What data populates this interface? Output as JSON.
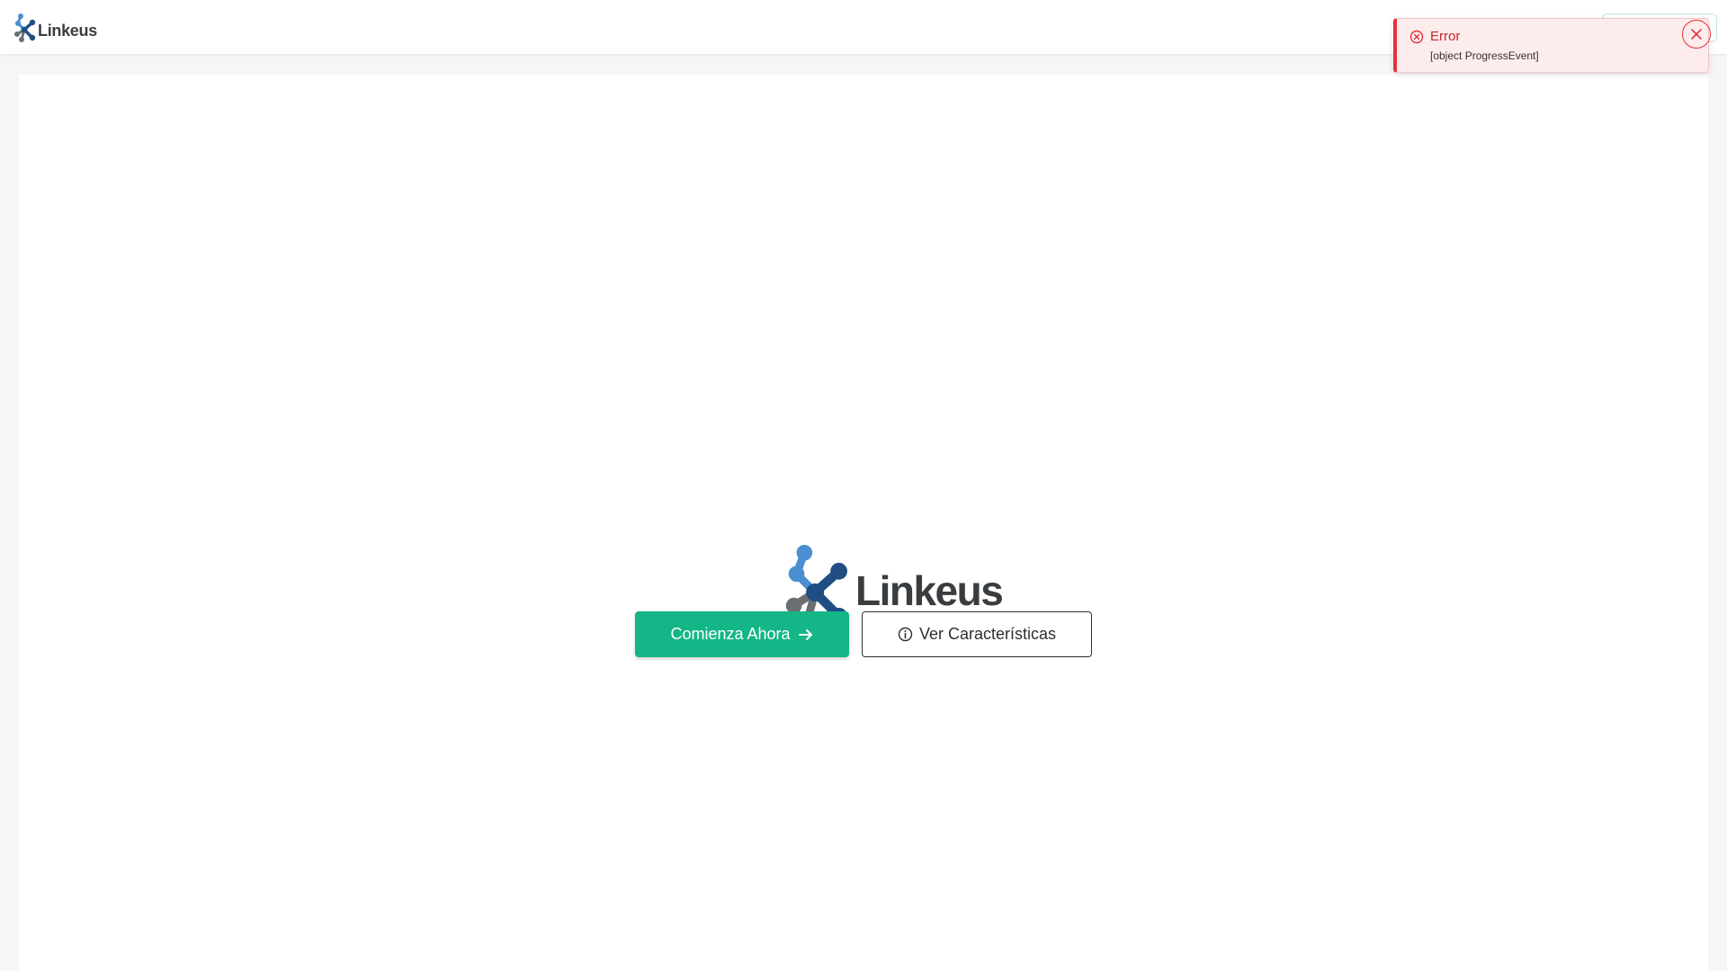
{
  "navbar": {
    "logo_text": "Linkeus"
  },
  "hero": {
    "logo_text": "Linkeus",
    "primary_button_label": "Comienza Ahora",
    "secondary_button_label": "Ver Características"
  },
  "toast": {
    "title": "Error",
    "message": "[object ProgressEvent]"
  },
  "icons": {
    "primary_button_icon": "arrow-right-icon",
    "secondary_button_icon": "info-circle-icon",
    "toast_icon": "error-circle-icon",
    "toast_close_icon": "close-icon"
  },
  "colors": {
    "accent": "#14b587",
    "error": "#e0343a",
    "logo_blue": "#4a8fd1",
    "logo_dark_blue": "#1f4e85",
    "logo_gray": "#6b6e72"
  }
}
